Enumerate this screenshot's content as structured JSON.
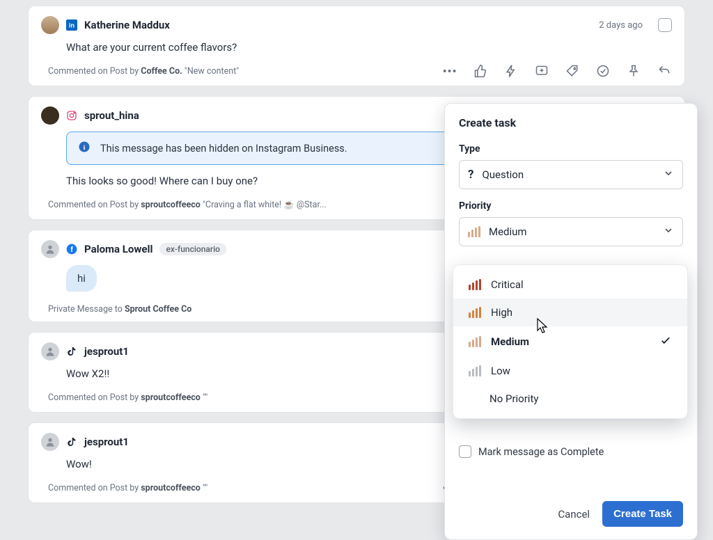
{
  "posts": [
    {
      "network": "linkedin",
      "author": "Katherine Maddux",
      "timestamp": "2 days ago",
      "body": "What are your current coffee flavors?",
      "meta_prefix": "Commented on Post by ",
      "meta_bold": "Coffee Co.",
      "meta_quote": " \"New content\""
    },
    {
      "network": "instagram",
      "author": "sprout_hina",
      "banner": "This message has been hidden on Instagram Business.",
      "body": "This looks so good! Where can I buy one?",
      "meta_prefix": "Commented on Post by ",
      "meta_bold": "sproutcoffeeco",
      "meta_quote": " \"Craving a flat white! ☕ @Star..."
    },
    {
      "network": "facebook",
      "author": "Paloma Lowell",
      "tag": "ex-funcionario",
      "body": "hi",
      "meta_plain": "Private Message to ",
      "meta_bold": "Sprout Coffee Co"
    },
    {
      "network": "tiktok",
      "author": "jesprout1",
      "body": "Wow X2!!",
      "meta_prefix": "Commented on Post by ",
      "meta_bold": "sproutcoffeeco",
      "meta_quote": " \"\""
    },
    {
      "network": "tiktok",
      "author": "jesprout1",
      "body": "Wow!",
      "meta_prefix": "Commented on Post by ",
      "meta_bold": "sproutcoffeeco",
      "meta_quote": " \"\""
    }
  ],
  "task_panel": {
    "title": "Create task",
    "type_label": "Type",
    "type_value": "Question",
    "priority_label": "Priority",
    "priority_value": "Medium",
    "mark_complete": "Mark message as Complete",
    "cancel": "Cancel",
    "submit": "Create Task"
  },
  "priority_options": [
    {
      "label": "Critical",
      "color": "#b0452e"
    },
    {
      "label": "High",
      "color": "#d6813f"
    },
    {
      "label": "Medium",
      "color": "#d9a98b",
      "selected": true
    },
    {
      "label": "Low",
      "color": "#b7bbc0"
    },
    {
      "label": "No Priority",
      "nobars": true
    }
  ]
}
